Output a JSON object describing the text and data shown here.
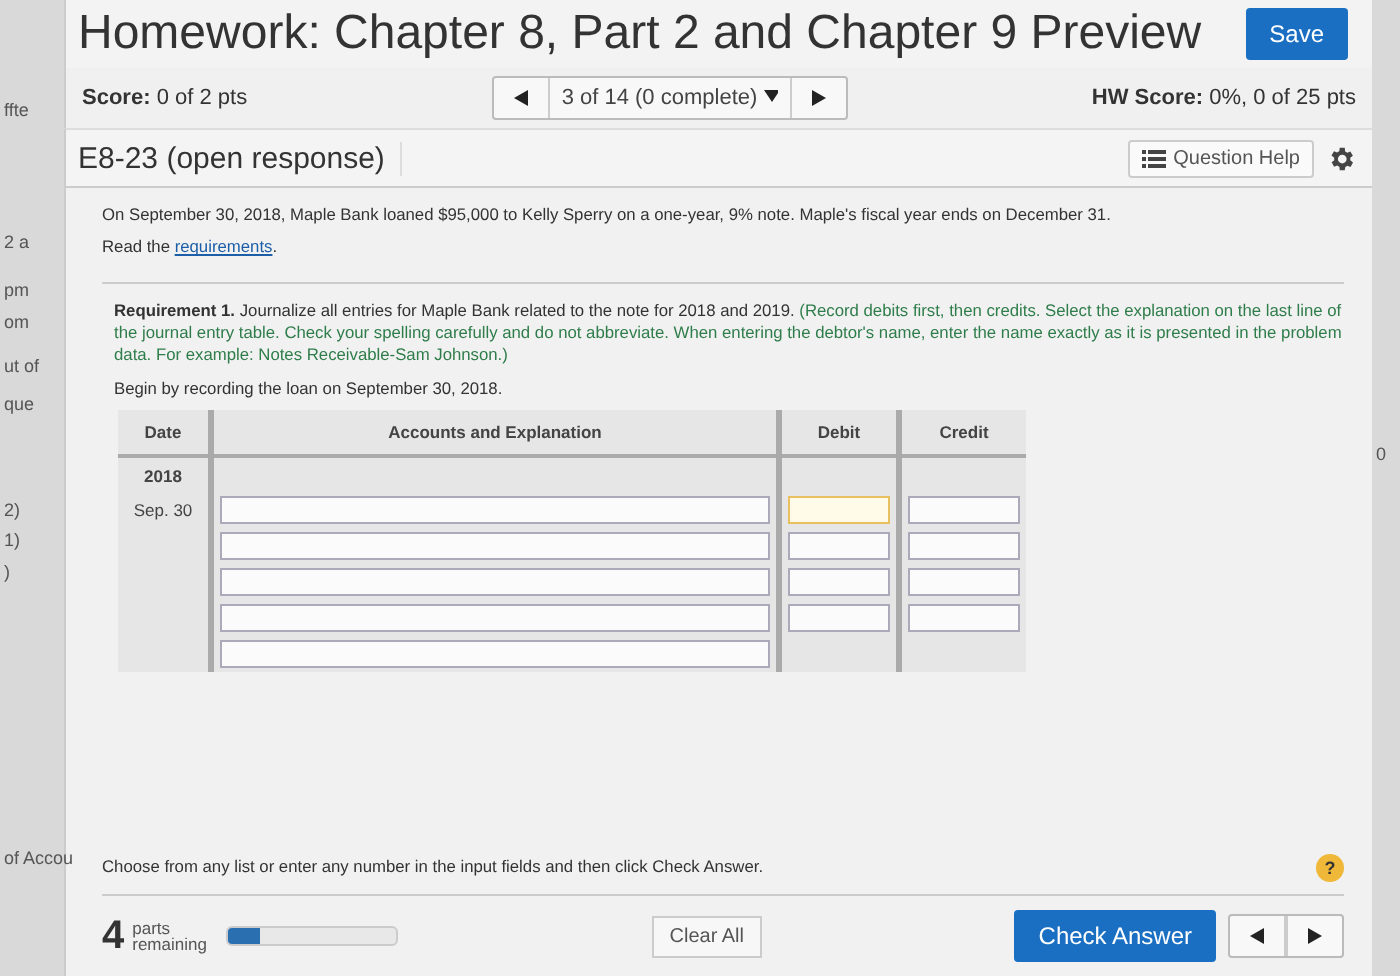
{
  "background_fragments": [
    "ffte",
    "2 a",
    "pm",
    "om",
    "ut of",
    "que",
    "2)",
    "1)",
    ")",
    "of Accou"
  ],
  "right_fragment": "0",
  "header": {
    "title": "Homework: Chapter 8, Part 2 and Chapter 9 Preview",
    "save": "Save"
  },
  "score_bar": {
    "score_label": "Score:",
    "score": "0 of 2 pts",
    "nav_position": "3 of 14 (0 complete)",
    "hw_label": "HW Score:",
    "hw_score": "0%, 0 of 25 pts"
  },
  "question": {
    "title": "E8-23 (open response)",
    "help": "Question Help"
  },
  "problem": {
    "statement": "On September 30, 2018, Maple Bank loaned $95,000 to Kelly Sperry on a one-year, 9% note. Maple's fiscal year ends on December 31.",
    "read_prefix": "Read the",
    "read_link": "requirements",
    "read_suffix": "."
  },
  "requirement": {
    "label": "Requirement 1.",
    "text": "Journalize all entries for Maple Bank related to the note for 2018 and 2019.",
    "instructions": "(Record debits first, then credits. Select the explanation on the last line of the journal entry table. Check your spelling carefully and do not abbreviate. When entering the debtor's name, enter the name exactly as it is presented in the problem data. For example: Notes Receivable-Sam Johnson.)"
  },
  "begin_text": "Begin by recording the loan on September 30, 2018.",
  "journal": {
    "columns": [
      "Date",
      "Accounts and Explanation",
      "Debit",
      "Credit"
    ],
    "year": "2018",
    "rows": [
      {
        "date": "Sep. 30",
        "kind": "full",
        "debit_focused": true
      },
      {
        "kind": "full",
        "debit_focused": false
      },
      {
        "kind": "full",
        "debit_focused": false
      },
      {
        "kind": "full",
        "debit_focused": false
      },
      {
        "kind": "account_only"
      }
    ]
  },
  "footer": {
    "hint": "Choose from any list or enter any number in the input fields and then click Check Answer.",
    "help_mark": "?",
    "parts_count": "4",
    "parts_label": "parts",
    "remaining_label": "remaining",
    "level": 0.18,
    "clear": "Clear All",
    "check": "Check Answer"
  }
}
